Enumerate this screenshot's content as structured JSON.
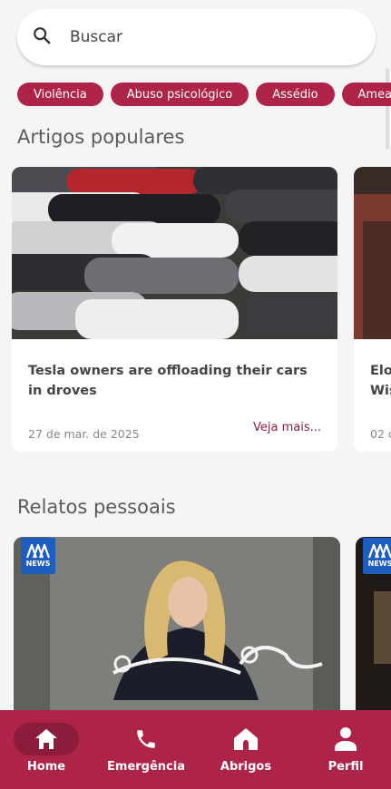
{
  "search": {
    "placeholder": "Buscar"
  },
  "chips": [
    "Violência",
    "Abuso psicológico",
    "Assédio",
    "Amea"
  ],
  "sections": {
    "popular": "Artigos populares",
    "personal": "Relatos pessoais"
  },
  "articles": [
    {
      "title": "Tesla owners are offloading their cars in droves",
      "date": "27 de mar. de 2025",
      "more": "Veja mais..."
    },
    {
      "title": "Elo\nWis",
      "date": "02 d"
    }
  ],
  "stories": [
    {
      "badge": "NEWS"
    },
    {
      "badge": "NEWS"
    }
  ],
  "nav": [
    {
      "label": "Home",
      "icon": "home-icon",
      "active": true
    },
    {
      "label": "Emergência",
      "icon": "phone-icon"
    },
    {
      "label": "Abrigos",
      "icon": "shelter-icon"
    },
    {
      "label": "Perfil",
      "icon": "person-icon"
    }
  ],
  "colors": {
    "accent": "#ae2449",
    "accentDark": "#8b1c3b",
    "badge": "#1d5dbf"
  }
}
